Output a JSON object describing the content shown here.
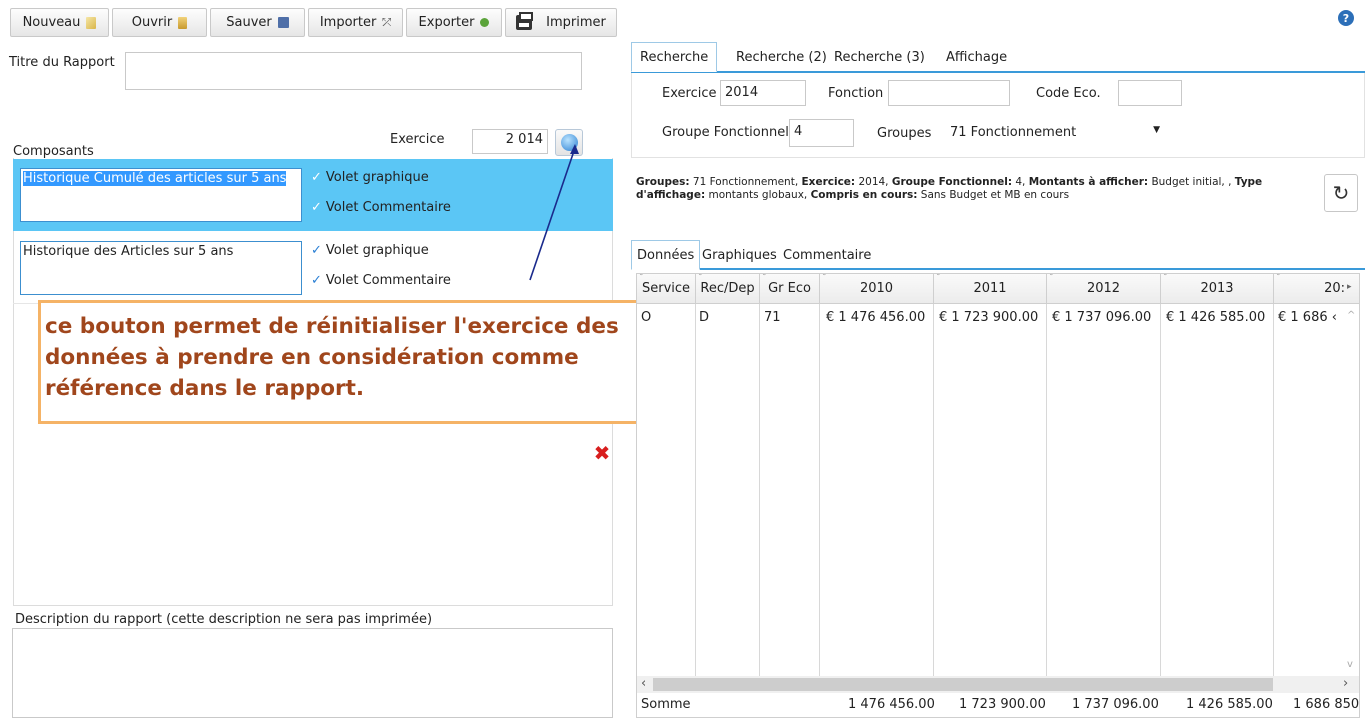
{
  "toolbar": {
    "new_label": "Nouveau",
    "open_label": "Ouvrir",
    "save_label": "Sauver",
    "import_label": "Importer",
    "export_label": "Exporter",
    "print_label": "Imprimer"
  },
  "help_icon": "?",
  "report": {
    "title_label": "Titre du Rapport",
    "title_value": "",
    "components_label": "Composants",
    "exercice_label": "Exercice",
    "exercice_value": "2 014",
    "components": [
      {
        "name": "Historique Cumulé des articles sur 5 ans",
        "graph_label": "Volet graphique",
        "comment_label": "Volet Commentaire"
      },
      {
        "name": "Historique des Articles sur 5 ans",
        "graph_label": "Volet graphique",
        "comment_label": "Volet Commentaire"
      }
    ],
    "description_label": "Description du rapport (cette  description ne sera pas imprimée)",
    "description_value": ""
  },
  "annotation": "ce bouton permet de réinitialiser l'exercice des données à prendre en considération comme référence dans le rapport.",
  "search": {
    "tabs": [
      "Recherche",
      "Recherche (2)",
      "Recherche (3)",
      "Affichage"
    ],
    "exercice_label": "Exercice",
    "exercice_value": "2014",
    "fonction_label": "Fonction",
    "fonction_value": "",
    "code_eco_label": "Code Eco.",
    "code_eco_value": "",
    "groupe_fonct_label": "Groupe Fonctionnel",
    "groupe_fonct_value": "4",
    "groupes_label": "Groupes",
    "groupes_value": "71 Fonctionnement"
  },
  "summary": {
    "groupes_k": "Groupes:",
    "groupes_v": " 71 Fonctionnement, ",
    "exercice_k": "Exercice:",
    "exercice_v": " 2014, ",
    "gf_k": "Groupe Fonctionnel:",
    "gf_v": " 4, ",
    "montants_k": "Montants à afficher:",
    "montants_v": " Budget initial, , ",
    "type_k": "Type d'affichage:",
    "type_v": " montants globaux, ",
    "compris_k": "Compris en cours:",
    "compris_v": " Sans Budget et MB en cours"
  },
  "data_tabs": [
    "Données",
    "Graphiques",
    "Commentaire"
  ],
  "grid": {
    "headers": [
      "Service",
      "Rec/Dep",
      "Gr Eco",
      "2010",
      "2011",
      "2012",
      "2013",
      "20:"
    ],
    "row": [
      "O",
      "D",
      "71",
      "€ 1 476 456.00",
      "€ 1 723 900.00",
      "€ 1 737 096.00",
      "€ 1 426 585.00",
      "€ 1 686 ‹"
    ],
    "footer_label": "Somme",
    "footer": [
      "1 476 456.00",
      "1 723 900.00",
      "1 737 096.00",
      "1 426 585.00",
      "1 686 850"
    ]
  }
}
